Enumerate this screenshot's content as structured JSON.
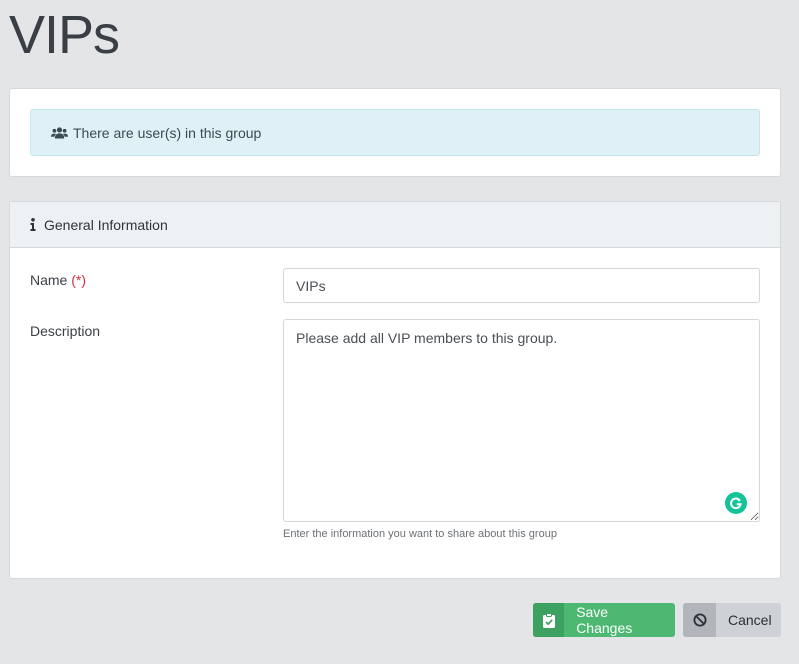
{
  "page": {
    "title": "VIPs"
  },
  "alert": {
    "icon": "users-icon",
    "text": "There are user(s) in this group"
  },
  "general_info": {
    "icon": "info-icon",
    "header": "General Information",
    "name_label": "Name",
    "required_marker": "(*)",
    "name_value": "VIPs",
    "description_label": "Description",
    "description_value": "Please add all VIP members to this group.",
    "description_help": "Enter the information you want to share about this group"
  },
  "actions": {
    "save_label": "Save Changes",
    "save_icon": "clipboard-check-icon",
    "cancel_label": "Cancel",
    "cancel_icon": "ban-icon"
  },
  "colors": {
    "save": "#4cb871",
    "cancel": "#ced1d5",
    "alert_bg": "#dff1f7",
    "required": "#d32f3d",
    "grammarly": "#15c39a"
  }
}
